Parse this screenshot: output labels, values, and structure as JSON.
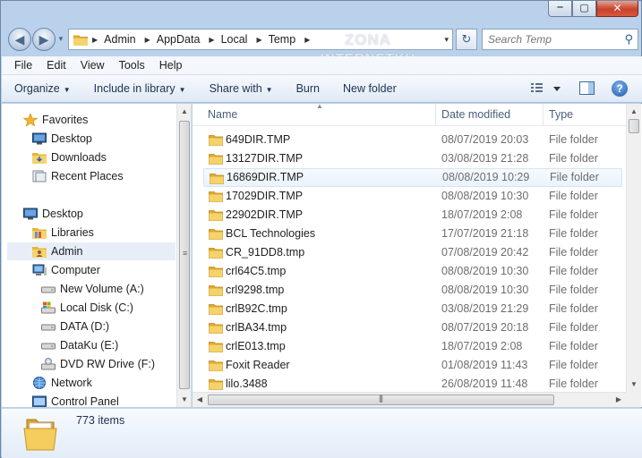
{
  "window": {
    "controls": {
      "minimize": "‒",
      "maximize": "▢",
      "close": "✕"
    }
  },
  "address": {
    "crumbs": [
      "Admin",
      "AppData",
      "Local",
      "Temp"
    ],
    "separator": "▶",
    "dropdown": "▾"
  },
  "search": {
    "placeholder": "Search Temp"
  },
  "watermark": {
    "line1": "ZONA",
    "line2": "INTERNETKU"
  },
  "menu": [
    "File",
    "Edit",
    "View",
    "Tools",
    "Help"
  ],
  "toolbar": {
    "organize": "Organize",
    "include_in_library": "Include in library",
    "share_with": "Share with",
    "burn": "Burn",
    "new_folder": "New folder",
    "dropdown_arrow": "▼",
    "help": "?"
  },
  "nav": {
    "favorites": "Favorites",
    "desktop_fav": "Desktop",
    "downloads": "Downloads",
    "recent_places": "Recent Places",
    "desktop": "Desktop",
    "libraries": "Libraries",
    "admin": "Admin",
    "computer": "Computer",
    "drives": [
      "New Volume (A:)",
      "Local Disk (C:)",
      "DATA (D:)",
      "DataKu (E:)",
      "DVD RW Drive (F:)"
    ],
    "network": "Network",
    "control_panel": "Control Panel"
  },
  "columns": {
    "name": "Name",
    "date": "Date modified",
    "type": "Type"
  },
  "files": [
    {
      "name": "649DIR.TMP",
      "date": "08/07/2019 20:03",
      "type": "File folder"
    },
    {
      "name": "13127DIR.TMP",
      "date": "03/08/2019 21:28",
      "type": "File folder"
    },
    {
      "name": "16869DIR.TMP",
      "date": "08/08/2019 10:29",
      "type": "File folder"
    },
    {
      "name": "17029DIR.TMP",
      "date": "08/08/2019 10:30",
      "type": "File folder"
    },
    {
      "name": "22902DIR.TMP",
      "date": "18/07/2019 2:08",
      "type": "File folder"
    },
    {
      "name": "BCL Technologies",
      "date": "17/07/2019 21:18",
      "type": "File folder"
    },
    {
      "name": "CR_91DD8.tmp",
      "date": "07/08/2019 20:42",
      "type": "File folder"
    },
    {
      "name": "crl64C5.tmp",
      "date": "08/08/2019 10:30",
      "type": "File folder"
    },
    {
      "name": "crl9298.tmp",
      "date": "08/08/2019 10:30",
      "type": "File folder"
    },
    {
      "name": "crlB92C.tmp",
      "date": "03/08/2019 21:29",
      "type": "File folder"
    },
    {
      "name": "crlBA34.tmp",
      "date": "08/07/2019 20:18",
      "type": "File folder"
    },
    {
      "name": "crlE013.tmp",
      "date": "18/07/2019 2:08",
      "type": "File folder"
    },
    {
      "name": "Foxit Reader",
      "date": "01/08/2019 11:43",
      "type": "File folder"
    },
    {
      "name": "lilo.3488",
      "date": "26/08/2019 11:48",
      "type": "File folder"
    }
  ],
  "status": {
    "item_count": "773 items"
  },
  "colors": {
    "folder": "#e8b53a",
    "selection": "#e7eef7",
    "frame": "#b9d1ea"
  }
}
